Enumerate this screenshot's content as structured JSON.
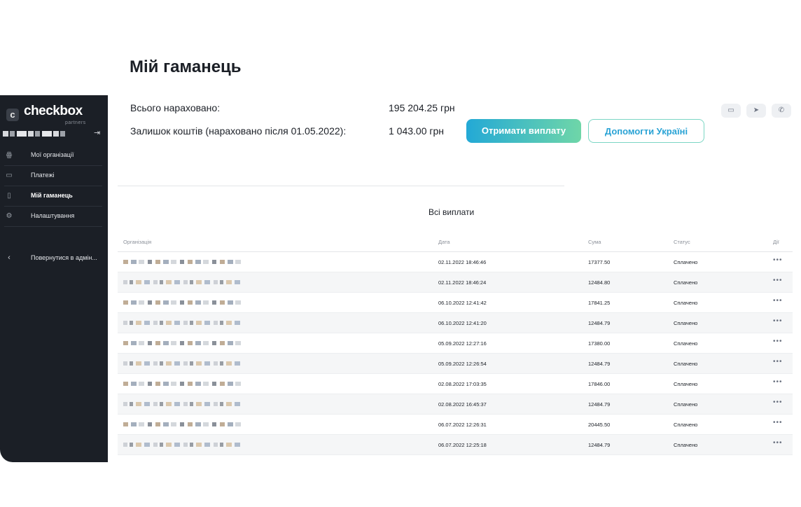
{
  "sidebar": {
    "logo_mark": "c",
    "logo_text": "checkbox",
    "logo_sub": "partners",
    "items": [
      {
        "label": "Мої організації",
        "icon": "users-icon"
      },
      {
        "label": "Платежі",
        "icon": "card-icon"
      },
      {
        "label": "Мій гаманець",
        "icon": "wallet-icon",
        "active": true
      },
      {
        "label": "Налаштування",
        "icon": "gear-icon"
      }
    ],
    "back_label": "Повернутися в адмін..."
  },
  "main": {
    "title": "Мій гаманець",
    "total_label": "Всього нараховано:",
    "total_value": "195 204.25 грн",
    "balance_label": "Залишок коштів (нараховано після 01.05.2022):",
    "balance_value": "1 043.00 грн",
    "payout_button": "Отримати виплату",
    "help_button": "Допомогти Україні",
    "section_title": "Всі виплати"
  },
  "table": {
    "columns": [
      "Організація",
      "Дата",
      "Сума",
      "Статус",
      "Дії"
    ],
    "rows": [
      {
        "date": "02.11.2022 18:46:46",
        "sum": "17377.50",
        "status": "Сплачено"
      },
      {
        "date": "02.11.2022 18:46:24",
        "sum": "12484.80",
        "status": "Сплачено"
      },
      {
        "date": "06.10.2022 12:41:42",
        "sum": "17841.25",
        "status": "Сплачено"
      },
      {
        "date": "06.10.2022 12:41:20",
        "sum": "12484.79",
        "status": "Сплачено"
      },
      {
        "date": "05.09.2022 12:27:16",
        "sum": "17380.00",
        "status": "Сплачено"
      },
      {
        "date": "05.09.2022 12:26:54",
        "sum": "12484.79",
        "status": "Сплачено"
      },
      {
        "date": "02.08.2022 17:03:35",
        "sum": "17846.00",
        "status": "Сплачено"
      },
      {
        "date": "02.08.2022 16:45:37",
        "sum": "12484.79",
        "status": "Сплачено"
      },
      {
        "date": "06.07.2022 12:26:31",
        "sum": "20445.50",
        "status": "Сплачено"
      },
      {
        "date": "06.07.2022 12:25:18",
        "sum": "12484.79",
        "status": "Сплачено"
      }
    ],
    "actions_glyph": "•••"
  },
  "colors": {
    "sidebar_bg": "#1b1f26",
    "accent_start": "#23a9d6",
    "accent_end": "#6fd6a8"
  }
}
